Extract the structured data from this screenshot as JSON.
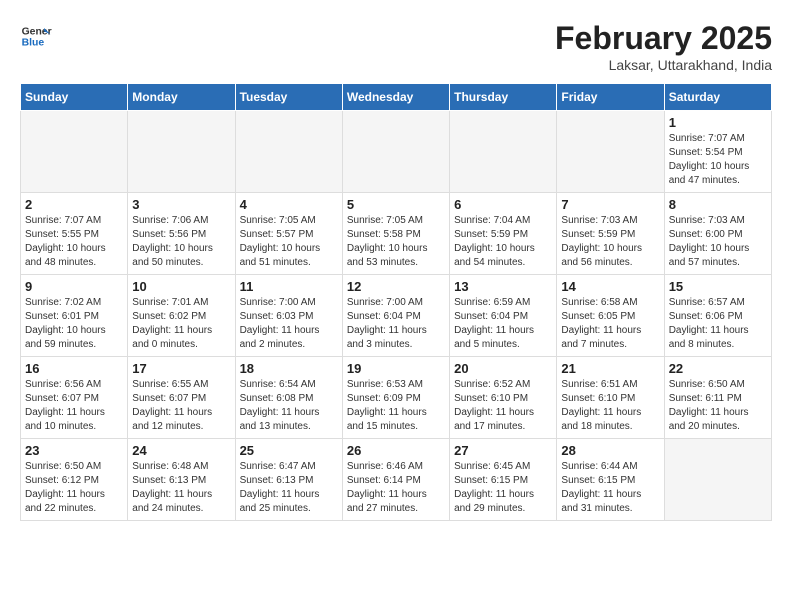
{
  "header": {
    "logo_general": "General",
    "logo_blue": "Blue",
    "month_year": "February 2025",
    "location": "Laksar, Uttarakhand, India"
  },
  "weekdays": [
    "Sunday",
    "Monday",
    "Tuesday",
    "Wednesday",
    "Thursday",
    "Friday",
    "Saturday"
  ],
  "weeks": [
    [
      {
        "day": "",
        "info": ""
      },
      {
        "day": "",
        "info": ""
      },
      {
        "day": "",
        "info": ""
      },
      {
        "day": "",
        "info": ""
      },
      {
        "day": "",
        "info": ""
      },
      {
        "day": "",
        "info": ""
      },
      {
        "day": "1",
        "info": "Sunrise: 7:07 AM\nSunset: 5:54 PM\nDaylight: 10 hours and 47 minutes."
      }
    ],
    [
      {
        "day": "2",
        "info": "Sunrise: 7:07 AM\nSunset: 5:55 PM\nDaylight: 10 hours and 48 minutes."
      },
      {
        "day": "3",
        "info": "Sunrise: 7:06 AM\nSunset: 5:56 PM\nDaylight: 10 hours and 50 minutes."
      },
      {
        "day": "4",
        "info": "Sunrise: 7:05 AM\nSunset: 5:57 PM\nDaylight: 10 hours and 51 minutes."
      },
      {
        "day": "5",
        "info": "Sunrise: 7:05 AM\nSunset: 5:58 PM\nDaylight: 10 hours and 53 minutes."
      },
      {
        "day": "6",
        "info": "Sunrise: 7:04 AM\nSunset: 5:59 PM\nDaylight: 10 hours and 54 minutes."
      },
      {
        "day": "7",
        "info": "Sunrise: 7:03 AM\nSunset: 5:59 PM\nDaylight: 10 hours and 56 minutes."
      },
      {
        "day": "8",
        "info": "Sunrise: 7:03 AM\nSunset: 6:00 PM\nDaylight: 10 hours and 57 minutes."
      }
    ],
    [
      {
        "day": "9",
        "info": "Sunrise: 7:02 AM\nSunset: 6:01 PM\nDaylight: 10 hours and 59 minutes."
      },
      {
        "day": "10",
        "info": "Sunrise: 7:01 AM\nSunset: 6:02 PM\nDaylight: 11 hours and 0 minutes."
      },
      {
        "day": "11",
        "info": "Sunrise: 7:00 AM\nSunset: 6:03 PM\nDaylight: 11 hours and 2 minutes."
      },
      {
        "day": "12",
        "info": "Sunrise: 7:00 AM\nSunset: 6:04 PM\nDaylight: 11 hours and 3 minutes."
      },
      {
        "day": "13",
        "info": "Sunrise: 6:59 AM\nSunset: 6:04 PM\nDaylight: 11 hours and 5 minutes."
      },
      {
        "day": "14",
        "info": "Sunrise: 6:58 AM\nSunset: 6:05 PM\nDaylight: 11 hours and 7 minutes."
      },
      {
        "day": "15",
        "info": "Sunrise: 6:57 AM\nSunset: 6:06 PM\nDaylight: 11 hours and 8 minutes."
      }
    ],
    [
      {
        "day": "16",
        "info": "Sunrise: 6:56 AM\nSunset: 6:07 PM\nDaylight: 11 hours and 10 minutes."
      },
      {
        "day": "17",
        "info": "Sunrise: 6:55 AM\nSunset: 6:07 PM\nDaylight: 11 hours and 12 minutes."
      },
      {
        "day": "18",
        "info": "Sunrise: 6:54 AM\nSunset: 6:08 PM\nDaylight: 11 hours and 13 minutes."
      },
      {
        "day": "19",
        "info": "Sunrise: 6:53 AM\nSunset: 6:09 PM\nDaylight: 11 hours and 15 minutes."
      },
      {
        "day": "20",
        "info": "Sunrise: 6:52 AM\nSunset: 6:10 PM\nDaylight: 11 hours and 17 minutes."
      },
      {
        "day": "21",
        "info": "Sunrise: 6:51 AM\nSunset: 6:10 PM\nDaylight: 11 hours and 18 minutes."
      },
      {
        "day": "22",
        "info": "Sunrise: 6:50 AM\nSunset: 6:11 PM\nDaylight: 11 hours and 20 minutes."
      }
    ],
    [
      {
        "day": "23",
        "info": "Sunrise: 6:50 AM\nSunset: 6:12 PM\nDaylight: 11 hours and 22 minutes."
      },
      {
        "day": "24",
        "info": "Sunrise: 6:48 AM\nSunset: 6:13 PM\nDaylight: 11 hours and 24 minutes."
      },
      {
        "day": "25",
        "info": "Sunrise: 6:47 AM\nSunset: 6:13 PM\nDaylight: 11 hours and 25 minutes."
      },
      {
        "day": "26",
        "info": "Sunrise: 6:46 AM\nSunset: 6:14 PM\nDaylight: 11 hours and 27 minutes."
      },
      {
        "day": "27",
        "info": "Sunrise: 6:45 AM\nSunset: 6:15 PM\nDaylight: 11 hours and 29 minutes."
      },
      {
        "day": "28",
        "info": "Sunrise: 6:44 AM\nSunset: 6:15 PM\nDaylight: 11 hours and 31 minutes."
      },
      {
        "day": "",
        "info": ""
      }
    ]
  ]
}
